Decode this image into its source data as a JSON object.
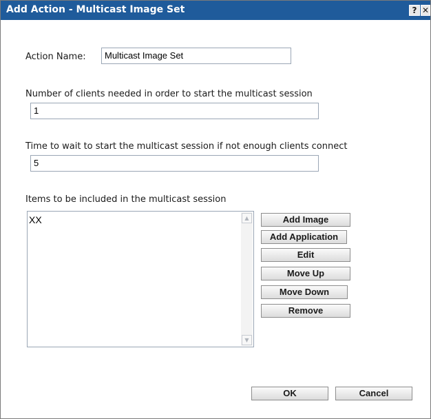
{
  "window": {
    "title": "Add Action - Multicast Image Set",
    "help_glyph": "?",
    "close_glyph": "✕"
  },
  "form": {
    "action_name_label": "Action Name:",
    "action_name_value": "Multicast Image Set",
    "clients_label": "Number of clients needed in order to start the multicast session",
    "clients_value": "1",
    "wait_label": "Time to wait to start the multicast session if not enough clients connect",
    "wait_value": "5",
    "items_label": "Items to be included in the multicast session",
    "items": [
      "XX"
    ]
  },
  "side_buttons": {
    "add_image": "Add Image",
    "add_application": "Add Application",
    "edit": "Edit",
    "move_up": "Move Up",
    "move_down": "Move Down",
    "remove": "Remove"
  },
  "footer": {
    "ok": "OK",
    "cancel": "Cancel"
  },
  "colors": {
    "titlebar": "#1f5b9b",
    "border": "#9aa6b5"
  },
  "icons": {
    "scroll_up": "triangle-up-icon",
    "scroll_down": "triangle-down-icon"
  }
}
